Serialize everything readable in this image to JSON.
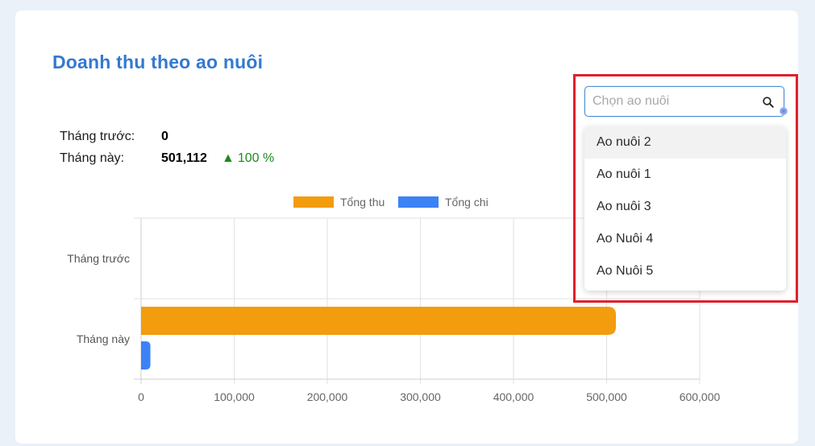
{
  "card": {
    "title": "Doanh thu theo ao nuôi"
  },
  "stats": {
    "prev_label": "Tháng trước:",
    "prev_value": "0",
    "curr_label": "Tháng này:",
    "curr_value": "501,112",
    "change_arrow": "▲",
    "change_value": "100 %",
    "change_color": "#1b8a1f"
  },
  "pond_select": {
    "placeholder": "Chọn ao nuôi",
    "icon": "search-icon",
    "options": [
      "Ao nuôi 2",
      "Ao nuôi 1",
      "Ao nuôi 3",
      "Ao Nuôi 4",
      "Ao Nuôi 5"
    ],
    "highlighted_index": 0
  },
  "chart_data": {
    "type": "bar",
    "orientation": "horizontal",
    "categories": [
      "Tháng trước",
      "Tháng này"
    ],
    "series": [
      {
        "name": "Tổng thu",
        "color": "#f39c0e",
        "values": [
          0,
          510000
        ]
      },
      {
        "name": "Tổng chi",
        "color": "#3b82f6",
        "values": [
          0,
          10000
        ]
      }
    ],
    "xlim": [
      0,
      600000
    ],
    "x_ticks": [
      0,
      100000,
      200000,
      300000,
      400000,
      500000,
      600000
    ],
    "x_tick_labels": [
      "0",
      "100,000",
      "200,000",
      "300,000",
      "400,000",
      "500,000",
      "600,000"
    ],
    "grid": true,
    "legend_position": "top-center"
  }
}
